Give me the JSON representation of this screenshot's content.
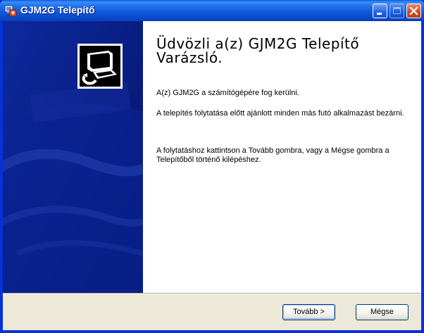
{
  "window": {
    "title": "GJM2G Telepítő"
  },
  "welcome": {
    "headline_line1": "Üdvözli a(z) GJM2G Telepítő",
    "headline_line2": "Varázsló.",
    "paragraph1": "A(z) GJM2G a számítógépére fog kerülni.",
    "paragraph2": "A telepítés folytatása előtt ajánlott minden más futó alkalmazást bezárni.",
    "paragraph3": "A folytatáshoz kattintson a Tovább gombra, vagy a Mégse gombra a Telepítőből történő kilépéshez."
  },
  "buttons": {
    "next_label": "Tovább >",
    "cancel_label": "Mégse"
  },
  "icons": {
    "app": "installer-icon",
    "minimize": "minimize-icon",
    "maximize": "maximize-icon",
    "close": "close-icon",
    "banner": "installer-computer-icon"
  },
  "colors": {
    "titlebar": "#0b54d8",
    "sidepanel": "#071b86",
    "close_button": "#d54a22"
  }
}
